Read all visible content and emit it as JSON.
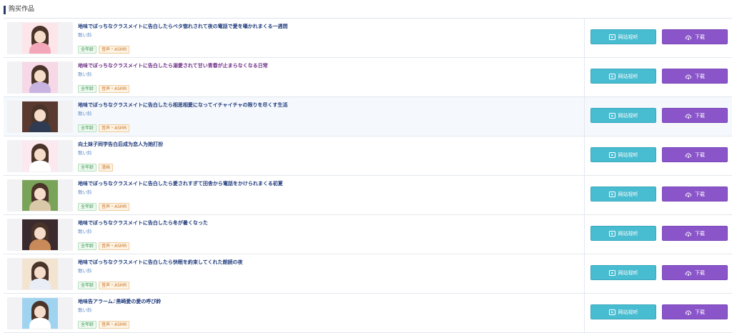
{
  "section": {
    "title": "购买作品"
  },
  "items": [
    {
      "title": "地味でぼっちなクラスメイトに告白したらベタ惚れされて夜の電話で愛を囁かれまくる一週間",
      "author": "歌い鈴",
      "age_tag": "全年龄",
      "genre_tag": "音声・ASMR",
      "title_color": "#1e3a7b",
      "cover_bg": "#fde6ea",
      "cover_body": "#f4a7b9",
      "watch_label": "网站视听",
      "download_label": "下载",
      "highlight": false
    },
    {
      "title": "地味でぼっちなクラスメイトに告白したら溺愛されて甘い青春が止まらなくなる日常",
      "author": "歌い鈴",
      "age_tag": "全年龄",
      "genre_tag": "音声・ASMR",
      "title_color": "#6d2f86",
      "cover_bg": "#f6d8e6",
      "cover_body": "#c9b3e0",
      "watch_label": "网站视听",
      "download_label": "下载",
      "highlight": false
    },
    {
      "title": "地味でぼっちなクラスメイトに告白したら相思相愛になってイチャイチャの限りを尽くす生活",
      "author": "歌い鈴",
      "age_tag": "全年龄",
      "genre_tag": "音声・ASMR",
      "title_color": "#1e3a7b",
      "cover_bg": "#5a3a30",
      "cover_body": "#2f3b52",
      "watch_label": "网站视听",
      "download_label": "下载",
      "highlight": true
    },
    {
      "title": "向土妹子同学告白后成为恋人为她打扮",
      "author": "歌い鈴",
      "age_tag": "全年龄",
      "genre_tag": "漫画",
      "title_color": "#1e3a7b",
      "cover_bg": "#fbe9ef",
      "cover_body": "#ffffff",
      "watch_label": "网站视听",
      "download_label": "下载",
      "highlight": false
    },
    {
      "title": "地味でぼっちなクラスメイトに告白したら愛されすぎて田舎から電話をかけられまくる初夏",
      "author": "歌い鈴",
      "age_tag": "全年龄",
      "genre_tag": "音声・ASMR",
      "title_color": "#1e3a7b",
      "cover_bg": "#7aa35a",
      "cover_body": "#d9c9a8",
      "watch_label": "网站视听",
      "download_label": "下载",
      "highlight": false
    },
    {
      "title": "地味でぼっちなクラスメイトに告白したら冬が暑くなった",
      "author": "歌い鈴",
      "age_tag": "全年龄",
      "genre_tag": "音声・ASMR",
      "title_color": "#1e3a7b",
      "cover_bg": "#3a2a2e",
      "cover_body": "#c98a5a",
      "watch_label": "网站视听",
      "download_label": "下载",
      "highlight": false
    },
    {
      "title": "地味でぼっちなクラスメイトに告白したら快眠を約束してくれた朗読の夜",
      "author": "歌い鈴",
      "age_tag": "全年龄",
      "genre_tag": "音声・ASMR",
      "title_color": "#1e3a7b",
      "cover_bg": "#f3e4d2",
      "cover_body": "#e9eef6",
      "watch_label": "网站视听",
      "download_label": "下载",
      "highlight": false
    },
    {
      "title": "地味告アラーム♪黒崎愛の愛の呼び鈴",
      "author": "歌い鈴",
      "age_tag": "全年龄",
      "genre_tag": "音声・ASMR",
      "title_color": "#1e3a7b",
      "cover_bg": "#9fd3ef",
      "cover_body": "#ffffff",
      "watch_label": "网站视听",
      "download_label": "下载",
      "highlight": false
    }
  ]
}
